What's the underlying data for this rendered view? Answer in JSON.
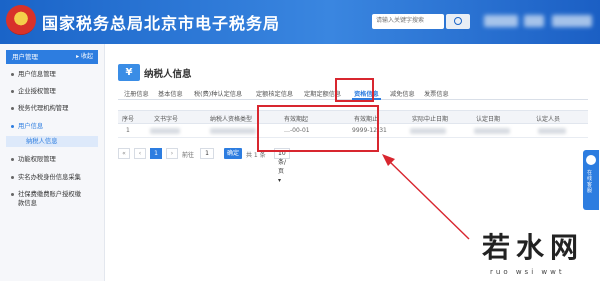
{
  "header": {
    "title": "国家税务总局北京市电子税务局",
    "search_placeholder": "请输入关键字搜索"
  },
  "sidebar": {
    "head_label": "用户管理",
    "head_ctrl": "▸ 收起",
    "items": [
      {
        "label": "用户信息管理"
      },
      {
        "label": "企业授权管理"
      },
      {
        "label": "税务代理机构管理"
      },
      {
        "label": "用户信息"
      }
    ],
    "sub_item": "纳税人信息",
    "more_items": [
      {
        "label": "功能权限管理"
      },
      {
        "label": "实名办税身份信息采集"
      },
      {
        "label": "社保费缴费账户授权缴款信息"
      }
    ]
  },
  "main": {
    "icon_glyph": "¥",
    "title": "纳税人信息",
    "tabs": [
      {
        "label": "注册信息"
      },
      {
        "label": "基本信息"
      },
      {
        "label": "税(费)种认定信息"
      },
      {
        "label": "定额核定信息"
      },
      {
        "label": "定期定额信息"
      },
      {
        "label": "资格信息"
      },
      {
        "label": "减免信息"
      },
      {
        "label": "发票信息"
      }
    ],
    "table": {
      "headers": [
        "序号",
        "文书字号",
        "纳税人资格类型",
        "有效期起",
        "有效期止",
        "实际中止日期",
        "认定日期",
        "认定人员"
      ],
      "rows": [
        {
          "index": "1",
          "start": "…-00-01",
          "end": "9999-12-31"
        }
      ]
    },
    "pager": {
      "first": "«",
      "prev": "‹",
      "page_label": "1",
      "next": "›",
      "last": "»",
      "goto_label": "前往",
      "page_input": "1",
      "go_btn": "确定",
      "total": "共 1 条",
      "page_size": "10 条/页 ▾"
    }
  },
  "float_panel": {
    "text": "在线客服"
  },
  "watermark": {
    "main": "若水网",
    "sub": "ruo  wsi  wwt"
  },
  "colors": {
    "header": "#1a64c8",
    "accent": "#2d7de0",
    "annotation": "#d8262f"
  }
}
